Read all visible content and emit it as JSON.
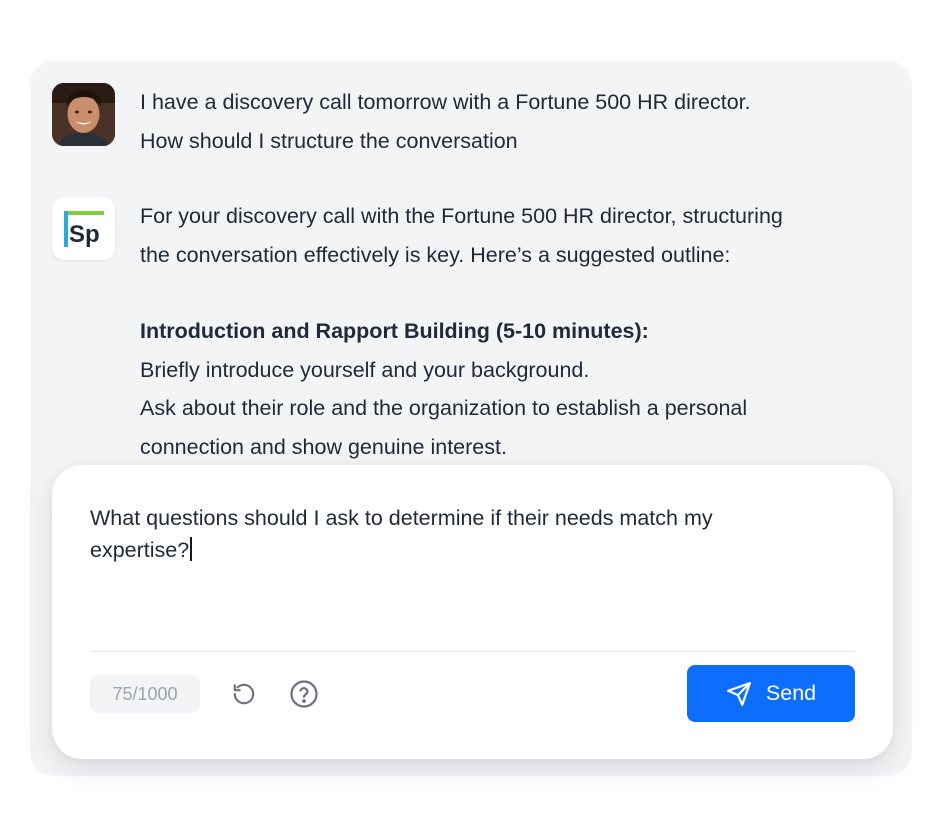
{
  "conversation": {
    "user_message": {
      "avatar_icon": "user-avatar-photo",
      "lines": [
        "I have a discovery call tomorrow with a Fortune 500 HR director.",
        "How should I structure the conversation"
      ]
    },
    "assistant_message": {
      "logo_text": "Sp",
      "logo_colors": {
        "green": "#7ccf3d",
        "blue": "#2aa8e0",
        "text": "#1f2937"
      },
      "intro_lines": [
        "For your discovery call with the Fortune 500 HR director, structuring",
        "the conversation effectively is key. Here’s a suggested outline:"
      ],
      "section_heading": "Introduction and Rapport Building (5-10 minutes):",
      "section_lines": [
        "Briefly introduce yourself and your background.",
        "Ask about their role and the organization to establish a personal",
        "connection and show genuine interest."
      ]
    }
  },
  "composer": {
    "input_value": "What questions should I ask to determine if their needs match my expertise?",
    "char_count": "75/1000",
    "reset_icon": "refresh-icon",
    "help_icon": "help-circle-icon",
    "send_label": "Send",
    "send_icon": "paper-plane-icon",
    "accent_color": "#0d6efd"
  }
}
